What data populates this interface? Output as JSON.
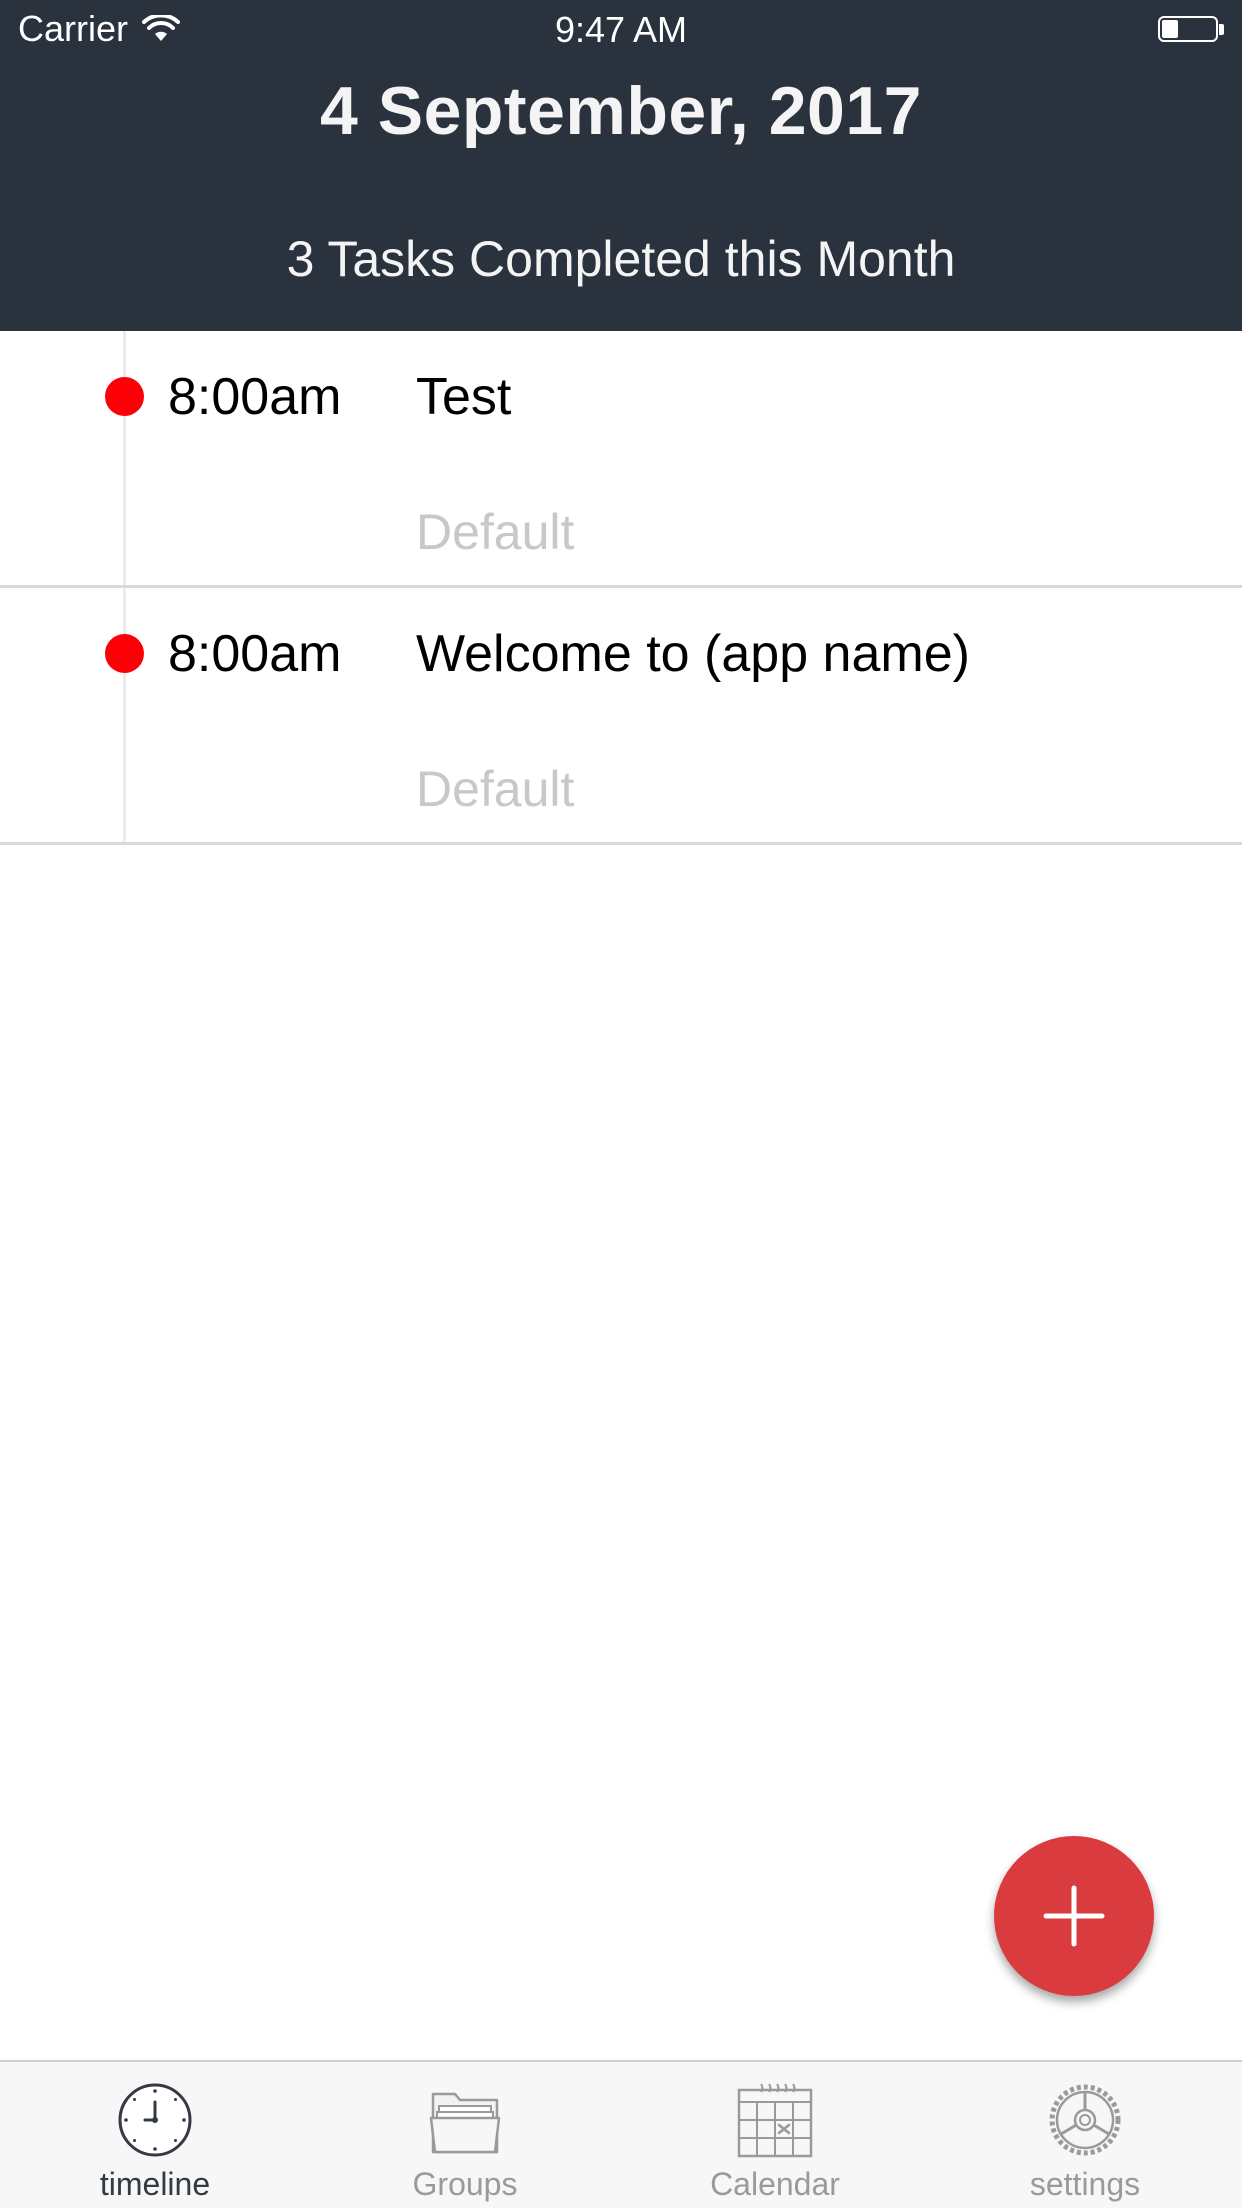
{
  "status_bar": {
    "carrier": "Carrier",
    "time": "9:47 AM",
    "battery_level": 0.3
  },
  "header": {
    "date": "4 September, 2017",
    "summary": "3 Tasks Completed this Month",
    "background_color": "#2a323e"
  },
  "tasks": [
    {
      "time": "8:00am",
      "title": "Test",
      "group": "Default",
      "dot_color": "#fb0007"
    },
    {
      "time": "8:00am",
      "title": "Welcome to (app name)",
      "group": "Default",
      "dot_color": "#fb0007"
    }
  ],
  "fab": {
    "icon": "plus-icon",
    "color": "#d93b3e"
  },
  "tab_bar": {
    "tabs": [
      {
        "label": "timeline",
        "icon": "clock-icon",
        "active": true
      },
      {
        "label": "Groups",
        "icon": "folder-icon",
        "active": false
      },
      {
        "label": "Calendar",
        "icon": "calendar-icon",
        "active": false
      },
      {
        "label": "settings",
        "icon": "gear-icon",
        "active": false
      }
    ]
  }
}
